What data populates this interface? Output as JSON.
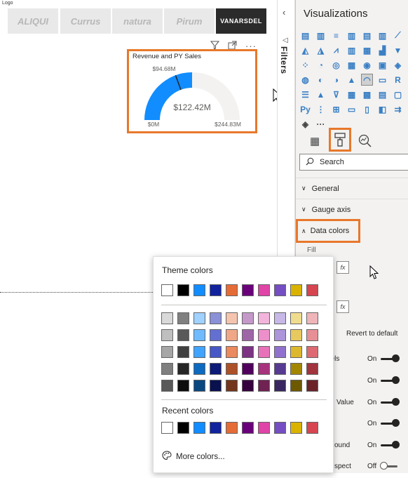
{
  "canvas": {
    "logo_label": "Logo",
    "logos": [
      "ALIQUI",
      "Currus",
      "natura",
      "Pirum",
      "VANARSDEL"
    ]
  },
  "visual": {
    "title": "Revenue and PY Sales",
    "value": "$122.42M",
    "target": "$94.68M",
    "min": "$0M",
    "max": "$244.83M",
    "value_fraction": 0.5,
    "target_fraction": 0.387,
    "fill_color": "#118DFF",
    "track_color": "#F3F2F1",
    "target_color": "#252423"
  },
  "filters": {
    "label": "Filters"
  },
  "viz_pane": {
    "title": "Visualizations",
    "search_placeholder": "Search",
    "sections": {
      "general": "General",
      "gauge_axis": "Gauge axis",
      "data_colors": "Data colors"
    },
    "fill_label": "Fill",
    "fx_label": "fx",
    "revert_label": "Revert to default",
    "toggles": [
      {
        "label": "bels",
        "state": "On"
      },
      {
        "label": "",
        "state": "On"
      },
      {
        "label": "Value",
        "state": "On"
      },
      {
        "label": "",
        "state": "On"
      },
      {
        "label": "ound",
        "state": "On"
      },
      {
        "label": "spect",
        "state": "Off"
      }
    ]
  },
  "color_picker": {
    "theme_title": "Theme colors",
    "recent_title": "Recent colors",
    "more_colors": "More colors...",
    "theme_colors": [
      "#FFFFFF",
      "#000000",
      "#118DFF",
      "#12239E",
      "#E66C37",
      "#6B007B",
      "#E044A7",
      "#744EC2",
      "#D9B300",
      "#D64550"
    ],
    "shades": [
      [
        "#D9D9D9",
        "#808080",
        "#A0D1FF",
        "#8A91D7",
        "#F5C4AF",
        "#C499CA",
        "#F3B4DC",
        "#C7B8E7",
        "#F0DC8F",
        "#EFB5B9"
      ],
      [
        "#BFBFBF",
        "#595959",
        "#70BBFF",
        "#6370D1",
        "#F0A787",
        "#9F66A7",
        "#EC8FCA",
        "#AC95DA",
        "#E7C95F",
        "#E68F95"
      ],
      [
        "#A6A6A6",
        "#404040",
        "#41A4FF",
        "#4857C6",
        "#EB895F",
        "#7C3384",
        "#E772B9",
        "#9071CE",
        "#DDB82F",
        "#DD6A72"
      ],
      [
        "#7F7F7F",
        "#262626",
        "#0D6ABF",
        "#0D1A77",
        "#AD5129",
        "#50005C",
        "#A8337D",
        "#573B92",
        "#A38600",
        "#A1343C"
      ],
      [
        "#595959",
        "#0D0D0D",
        "#094780",
        "#09114F",
        "#73361C",
        "#36003E",
        "#702253",
        "#3A2761",
        "#6D5A00",
        "#6B2328"
      ]
    ],
    "recent_colors": [
      "#FFFFFF",
      "#000000",
      "#118DFF",
      "#12239E",
      "#E66C37",
      "#6B007B",
      "#E044A7",
      "#744EC2",
      "#D9B300",
      "#D64550"
    ]
  },
  "colors": {
    "highlight": "#E8782B",
    "pane_bg": "#F3F2F1"
  }
}
